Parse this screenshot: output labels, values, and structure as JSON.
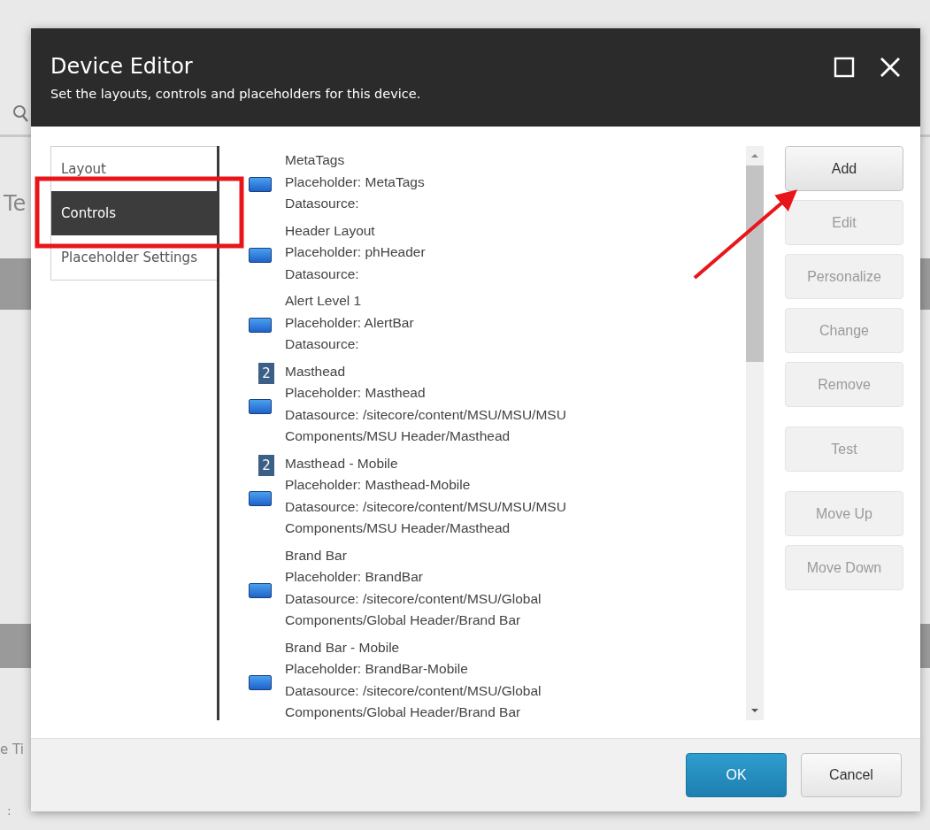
{
  "background_page": {
    "fragments": [
      {
        "kind": "search"
      },
      {
        "kind": "text",
        "text": "Te"
      },
      {
        "kind": "text",
        "text": "e Ti"
      },
      {
        "kind": "text",
        "text": ":"
      }
    ]
  },
  "dialog": {
    "title": "Device Editor",
    "subtitle": "Set the layouts, controls and placeholders for this device.",
    "window_buttons": [
      {
        "kind": "maximize"
      },
      {
        "kind": "close"
      }
    ],
    "nav": [
      {
        "label": "Layout",
        "selected": false
      },
      {
        "label": "Controls",
        "selected": true
      },
      {
        "label": "Placeholder Settings",
        "selected": false
      }
    ],
    "controls": [
      {
        "name": "MetaTags",
        "placeholder": "Placeholder: MetaTags",
        "datasource": "Datasource:"
      },
      {
        "name": "Header Layout",
        "placeholder": "Placeholder: phHeader",
        "datasource": "Datasource:"
      },
      {
        "name": "Alert Level 1",
        "placeholder": "Placeholder: AlertBar",
        "datasource": "Datasource:"
      },
      {
        "badge": "2",
        "name": "Masthead",
        "placeholder": "Placeholder: Masthead",
        "datasource": "Datasource: /sitecore/content/MSU/MSU/MSU Components/MSU Header/Masthead"
      },
      {
        "badge": "2",
        "name": "Masthead - Mobile",
        "placeholder": "Placeholder: Masthead-Mobile",
        "datasource": "Datasource: /sitecore/content/MSU/MSU/MSU Components/MSU Header/Masthead"
      },
      {
        "name": "Brand Bar",
        "placeholder": "Placeholder: BrandBar",
        "datasource": "Datasource: /sitecore/content/MSU/Global Components/Global Header/Brand Bar"
      },
      {
        "name": "Brand Bar - Mobile",
        "placeholder": "Placeholder: BrandBar-Mobile",
        "datasource": "Datasource: /sitecore/content/MSU/Global Components/Global Header/Brand Bar"
      }
    ],
    "actions": [
      {
        "label": "Add",
        "disabled": false
      },
      {
        "label": "Edit",
        "disabled": true
      },
      {
        "label": "Personalize",
        "disabled": true
      },
      {
        "label": "Change",
        "disabled": true
      },
      {
        "label": "Remove",
        "disabled": true,
        "gap_after": true
      },
      {
        "label": "Test",
        "disabled": true,
        "gap_after": true
      },
      {
        "label": "Move Up",
        "disabled": true
      },
      {
        "label": "Move Down",
        "disabled": true
      }
    ],
    "footer_buttons": [
      {
        "label": "OK",
        "kind": "primary"
      },
      {
        "label": "Cancel",
        "kind": "secondary"
      }
    ]
  }
}
